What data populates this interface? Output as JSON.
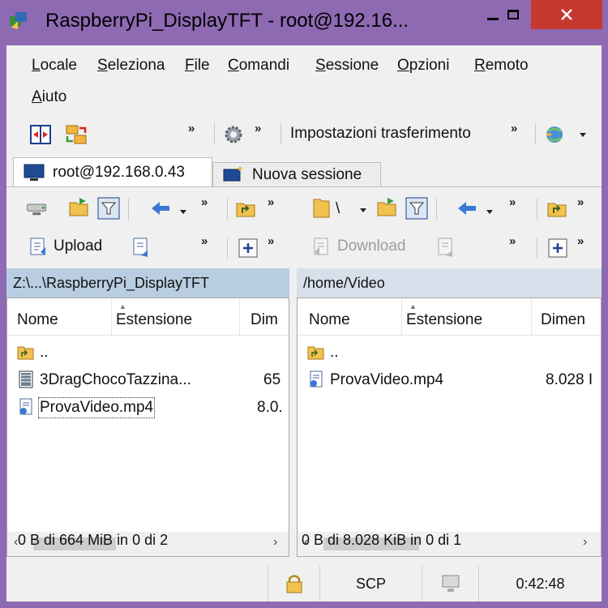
{
  "window": {
    "title": "RaspberryPi_DisplayTFT - root@192.16..."
  },
  "menu": {
    "items": [
      {
        "label": "Locale"
      },
      {
        "label": "Seleziona"
      },
      {
        "label": "File"
      },
      {
        "label": "Comandi"
      },
      {
        "label": "Sessione"
      },
      {
        "label": "Opzioni"
      },
      {
        "label": "Remoto"
      },
      {
        "label": "Aiuto"
      }
    ]
  },
  "toolbar": {
    "transfer_settings_label": "Impostazioni trasferimento",
    "overflow": "»"
  },
  "tabs": [
    {
      "label": "root@192.168.0.43"
    },
    {
      "label": "Nuova sessione"
    }
  ],
  "left_panel": {
    "action_label": "Upload",
    "path": "Z:\\...\\RaspberryPi_DisplayTFT",
    "columns": [
      "Nome",
      "Estensione",
      "Dim"
    ],
    "files": [
      {
        "name": "..",
        "size": ""
      },
      {
        "name": "3DragChocoTazzina...",
        "size": "65"
      },
      {
        "name": "ProvaVideo.mp4",
        "size": "8.0."
      }
    ],
    "status": "0 B di 664 MiB in 0 di 2"
  },
  "right_panel": {
    "dir_short": "\\",
    "action_label": "Download",
    "path": "/home/Video",
    "columns": [
      "Nome",
      "Estensione",
      "Dimen"
    ],
    "files": [
      {
        "name": "..",
        "size": ""
      },
      {
        "name": "ProvaVideo.mp4",
        "size": "8.028 I"
      }
    ],
    "status": "0 B di 8.028 KiB in 0 di 1"
  },
  "statusbar": {
    "protocol": "SCP",
    "elapsed": "0:42:48"
  },
  "colors": {
    "window_frame": "#8e6ab3",
    "close_button": "#c7392f",
    "active_path_bar": "#b9cde2",
    "inactive_path_bar": "#d6e0ea"
  }
}
